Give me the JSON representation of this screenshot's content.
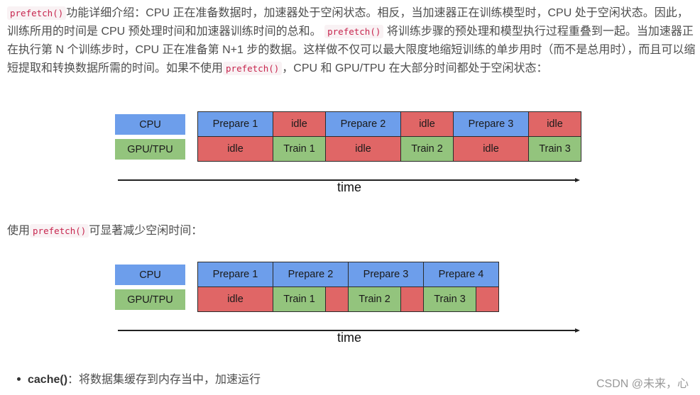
{
  "paragraph1": {
    "segments": [
      {
        "type": "code",
        "text": "prefetch()"
      },
      {
        "type": "text",
        "text": "功能详细介绍：CPU 正在准备数据时，加速器处于空闲状态。相反，当加速器正在训练模型时，CPU 处于空闲状态。因此，训练所用的时间是 CPU 预处理时间和加速器训练时间的总和。 "
      },
      {
        "type": "code",
        "text": "prefetch()"
      },
      {
        "type": "text",
        "text": " 将训练步骤的预处理和模型执行过程重叠到一起。当加速器正在执行第 N 个训练步时，CPU 正在准备第 N+1 步的数据。这样做不仅可以最大限度地缩短训练的单步用时（而不是总用时），而且可以缩短提取和转换数据所需的时间。如果不使用"
      },
      {
        "type": "code",
        "text": "prefetch()"
      },
      {
        "type": "text",
        "text": "，CPU 和 GPU/TPU 在大部分时间都处于空闲状态："
      }
    ]
  },
  "paragraph2": {
    "segments": [
      {
        "type": "text",
        "text": "使用"
      },
      {
        "type": "code",
        "text": "prefetch()"
      },
      {
        "type": "text",
        "text": "可显著减少空闲时间："
      }
    ]
  },
  "colors": {
    "cpu": "#6d9eeb",
    "gpu": "#93c47d",
    "idle": "#e06666"
  },
  "diagram_without_prefetch": {
    "legend": [
      "CPU",
      "GPU/TPU"
    ],
    "axis_label": "time",
    "cpu_row": [
      {
        "label": "Prepare 1",
        "kind": "cpu",
        "units": 2
      },
      {
        "label": "idle",
        "kind": "idle",
        "units": 1.4
      },
      {
        "label": "Prepare 2",
        "kind": "cpu",
        "units": 2
      },
      {
        "label": "idle",
        "kind": "idle",
        "units": 1.4
      },
      {
        "label": "Prepare 3",
        "kind": "cpu",
        "units": 2
      },
      {
        "label": "idle",
        "kind": "idle",
        "units": 1.4
      }
    ],
    "gpu_row": [
      {
        "label": "idle",
        "kind": "idle",
        "units": 2
      },
      {
        "label": "Train 1",
        "kind": "gpu",
        "units": 1.4
      },
      {
        "label": "idle",
        "kind": "idle",
        "units": 2
      },
      {
        "label": "Train 2",
        "kind": "gpu",
        "units": 1.4
      },
      {
        "label": "idle",
        "kind": "idle",
        "units": 2
      },
      {
        "label": "Train 3",
        "kind": "gpu",
        "units": 1.4
      }
    ]
  },
  "diagram_with_prefetch": {
    "legend": [
      "CPU",
      "GPU/TPU"
    ],
    "axis_label": "time",
    "cpu_row": [
      {
        "label": "Prepare 1",
        "kind": "cpu",
        "units": 2
      },
      {
        "label": "Prepare 2",
        "kind": "cpu",
        "units": 2
      },
      {
        "label": "Prepare 3",
        "kind": "cpu",
        "units": 2
      },
      {
        "label": "Prepare 4",
        "kind": "cpu",
        "units": 2
      }
    ],
    "gpu_row": [
      {
        "label": "idle",
        "kind": "idle",
        "units": 2
      },
      {
        "label": "Train 1",
        "kind": "gpu",
        "units": 1.4
      },
      {
        "label": "",
        "kind": "idle",
        "units": 0.6
      },
      {
        "label": "Train 2",
        "kind": "gpu",
        "units": 1.4
      },
      {
        "label": "",
        "kind": "idle",
        "units": 0.6
      },
      {
        "label": "Train 3",
        "kind": "gpu",
        "units": 1.4
      },
      {
        "label": "",
        "kind": "idle",
        "units": 0.6
      }
    ]
  },
  "bullet": {
    "bold": "cache()",
    "text": "：将数据集缓存到内存当中，加速运行"
  },
  "watermark": "CSDN @未来，心"
}
